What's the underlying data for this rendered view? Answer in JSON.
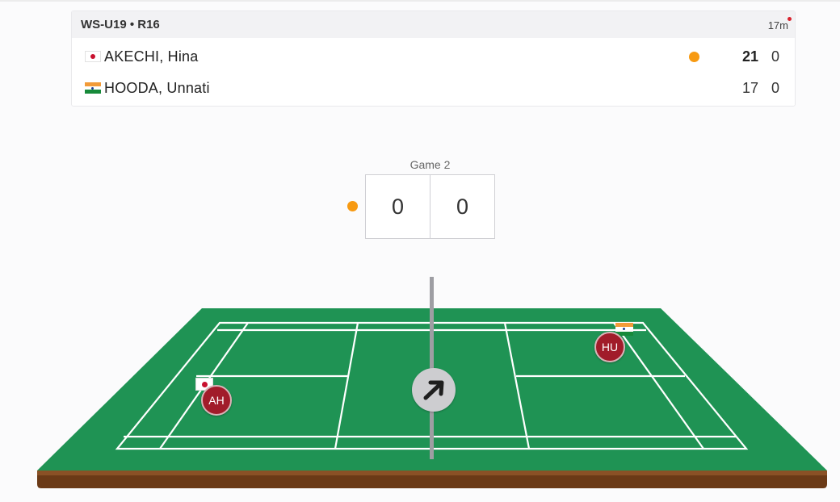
{
  "match": {
    "event": "WS-U19 • R16",
    "elapsed": "17m",
    "players": [
      {
        "name": "AKECHI, Hina",
        "flag": "japan-flag-icon",
        "serving": true,
        "game1": "21",
        "game1_bold": true,
        "game2": "0"
      },
      {
        "name": "HOODA, Unnati",
        "flag": "india-flag-icon",
        "serving": false,
        "game1": "17",
        "game1_bold": false,
        "game2": "0"
      }
    ]
  },
  "current_game": {
    "label": "Game 2",
    "scores": [
      "0",
      "0"
    ]
  },
  "court": {
    "players": [
      {
        "initials": "AH",
        "flag": "japan-flag-icon"
      },
      {
        "initials": "HU",
        "flag": "india-flag-icon"
      }
    ],
    "shuttle_icon": "arrow-up-right-icon"
  },
  "colors": {
    "serve_indicator": "#f79a12",
    "court_green": "#1f9354",
    "court_base": "#6b3a17",
    "player_token": "#a11c2a",
    "live_dot": "#d9232e"
  }
}
